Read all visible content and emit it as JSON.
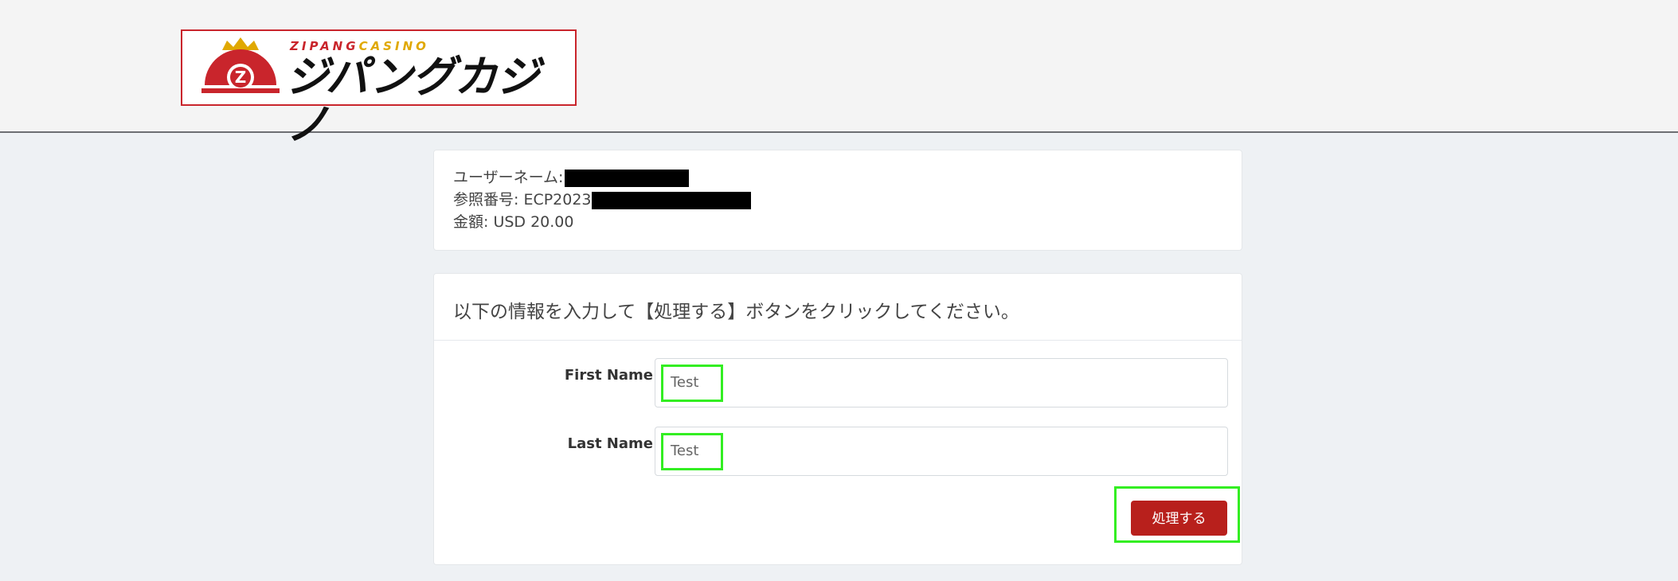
{
  "brand": {
    "logo_en_part1": "ZIPANG",
    "logo_en_part2": "CASINO",
    "logo_ja": "ジパングカジノ",
    "colors": {
      "red": "#c9252c",
      "gold": "#e0a800"
    }
  },
  "info": {
    "username_label": "ユーザーネーム:",
    "reference_label": "参照番号: ECP2023",
    "amount_label": "金額",
    "amount_value": ": USD 20.00"
  },
  "form": {
    "instruction": "以下の情報を入力して【処理する】ボタンをクリックしてください。",
    "first_name_label": "First Name",
    "first_name_value": "Test",
    "last_name_label": "Last Name",
    "last_name_value": "Test",
    "submit_label": "処理する",
    "accent_color": "#b8201c",
    "highlight_color": "#33ee22"
  }
}
